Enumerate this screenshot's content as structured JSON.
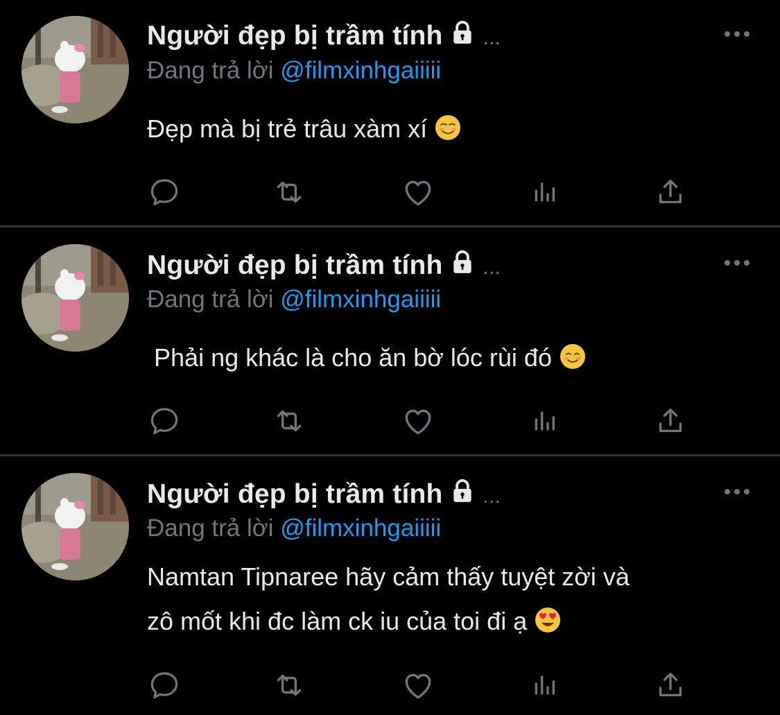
{
  "colors": {
    "background": "#000000",
    "text": "#e7e9ea",
    "muted": "#71767b",
    "link": "#1d9bf0",
    "divider": "#2f3336"
  },
  "tweets": [
    {
      "author": "Người đẹp bị trầm tính",
      "truncation": "...",
      "reply_prefix": "Đang trả lời",
      "reply_handle": "@filmxinhgaiiiii",
      "text": "Đẹp mà bị trẻ trâu xàm xí",
      "emoji": "relieved-smile-emoji"
    },
    {
      "author": "Người đẹp bị trầm tính",
      "truncation": "...",
      "reply_prefix": "Đang trả lời",
      "reply_handle": "@filmxinhgaiiiii",
      "text": " Phải ng khác là cho ăn bờ lóc rùi đó",
      "emoji": "smiling-blush-emoji"
    },
    {
      "author": "Người đẹp bị trầm tính",
      "truncation": "...",
      "reply_prefix": "Đang trả lời",
      "reply_handle": "@filmxinhgaiiiii",
      "text": "Namtan Tipnaree hãy cảm thấy tuyệt zời và\nzô mốt khi đc làm ck iu của toi đi ạ",
      "emoji": "heart-eyes-emoji"
    }
  ],
  "action_icons": [
    "reply-icon",
    "retweet-icon",
    "like-icon",
    "analytics-icon",
    "share-icon"
  ]
}
